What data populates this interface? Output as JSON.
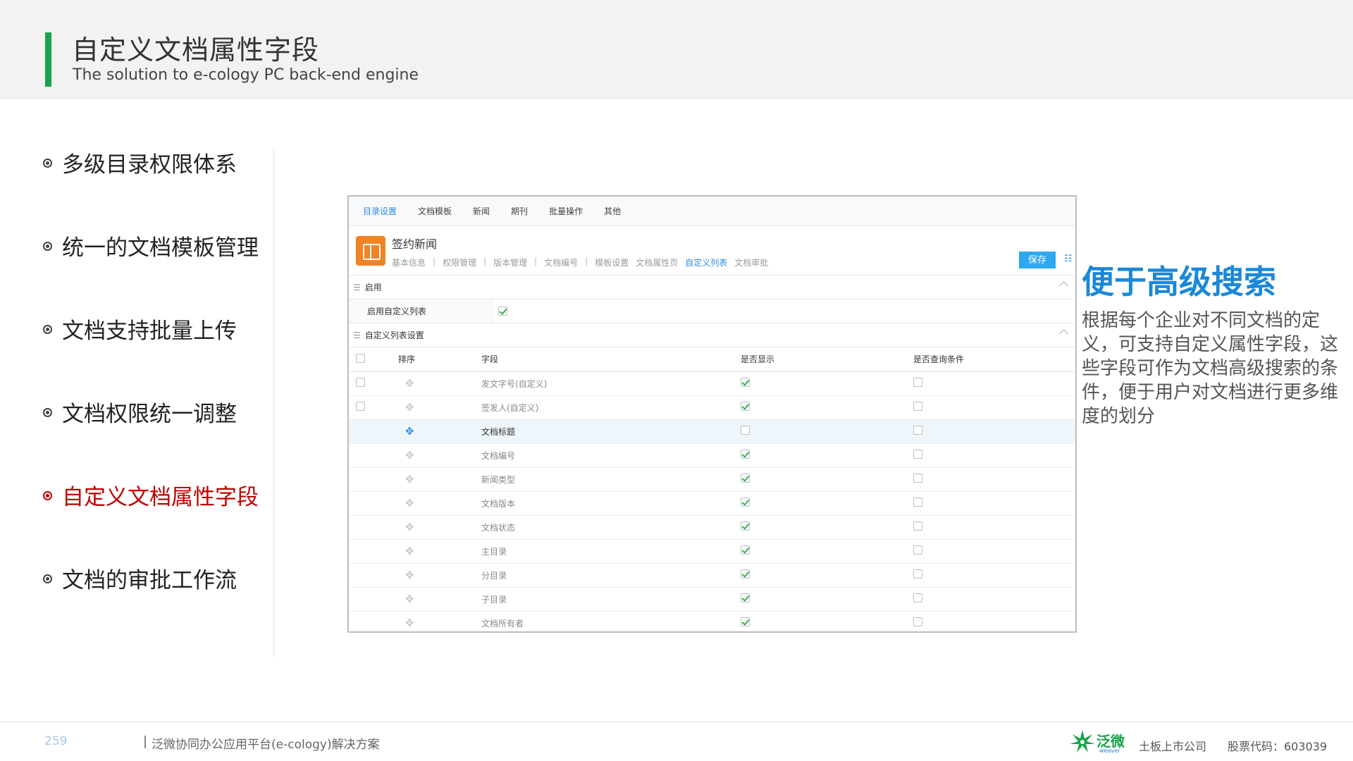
{
  "header": {
    "title": "自定义文档属性字段",
    "subtitle": "The solution to e-cology PC back-end engine"
  },
  "leftnav": {
    "items": [
      {
        "label": "多级目录权限体系",
        "active": false
      },
      {
        "label": "统一的文档模板管理",
        "active": false
      },
      {
        "label": "文档支持批量上传",
        "active": false
      },
      {
        "label": "文档权限统一调整",
        "active": false
      },
      {
        "label": "自定义文档属性字段",
        "active": true
      },
      {
        "label": "文档的审批工作流",
        "active": false
      }
    ]
  },
  "app": {
    "topnav": [
      "目录设置",
      "文档模板",
      "新闻",
      "期刊",
      "批量操作",
      "其他"
    ],
    "topnav_active": 0,
    "doc_title": "签约新闻",
    "subnav": [
      "基本信息",
      "权限管理",
      "版本管理",
      "文档编号",
      "模板设置",
      "文档属性页",
      "自定义列表",
      "文档审批"
    ],
    "subnav_active": 6,
    "save_label": "保存",
    "section_enable": "启用",
    "enable_label": "启用自定义列表",
    "enable_checked": true,
    "section_list": "自定义列表设置",
    "columns": [
      "排序",
      "字段",
      "是否显示",
      "是否查询条件"
    ],
    "rows": [
      {
        "field": "发文字号(自定义)",
        "show": true,
        "query": false,
        "select": true,
        "highlight": false
      },
      {
        "field": "签发人(自定义)",
        "show": true,
        "query": false,
        "select": true,
        "highlight": false
      },
      {
        "field": "文档标题",
        "show": false,
        "query": false,
        "select": false,
        "highlight": true
      },
      {
        "field": "文档编号",
        "show": true,
        "query": false,
        "select": false,
        "highlight": false
      },
      {
        "field": "新闻类型",
        "show": true,
        "query": false,
        "select": false,
        "highlight": false
      },
      {
        "field": "文档版本",
        "show": true,
        "query": false,
        "select": false,
        "highlight": false
      },
      {
        "field": "文档状态",
        "show": true,
        "query": false,
        "select": false,
        "highlight": false
      },
      {
        "field": "主目录",
        "show": true,
        "query": false,
        "select": false,
        "highlight": false
      },
      {
        "field": "分目录",
        "show": true,
        "query": false,
        "select": false,
        "highlight": false
      },
      {
        "field": "子目录",
        "show": true,
        "query": false,
        "select": false,
        "highlight": false
      },
      {
        "field": "文档所有者",
        "show": true,
        "query": false,
        "select": false,
        "highlight": false
      }
    ]
  },
  "right": {
    "title": "便于高级搜索",
    "description": "根据每个企业对不同文档的定义，可支持自定义属性字段，这些字段可作为文档高级搜索的条件，便于用户对文档进行更多维度的划分"
  },
  "footer": {
    "page_number": "259",
    "platform_text": "泛微协同办公应用平台(e-cology)解决方案",
    "brand": "泛微",
    "brand_en": "weaver",
    "listed": "土板上市公司",
    "stock_code": "股票代码：603039"
  },
  "colors": {
    "accent_green": "#1aa34a",
    "active_red": "#c00000",
    "link_blue": "#2e8bea",
    "title_blue": "#1a88d8",
    "doc_icon_orange": "#f28322"
  },
  "icons": {
    "doc_icon": "book-icon",
    "drag_handle": "move-icon",
    "list_view": "list-icon"
  }
}
